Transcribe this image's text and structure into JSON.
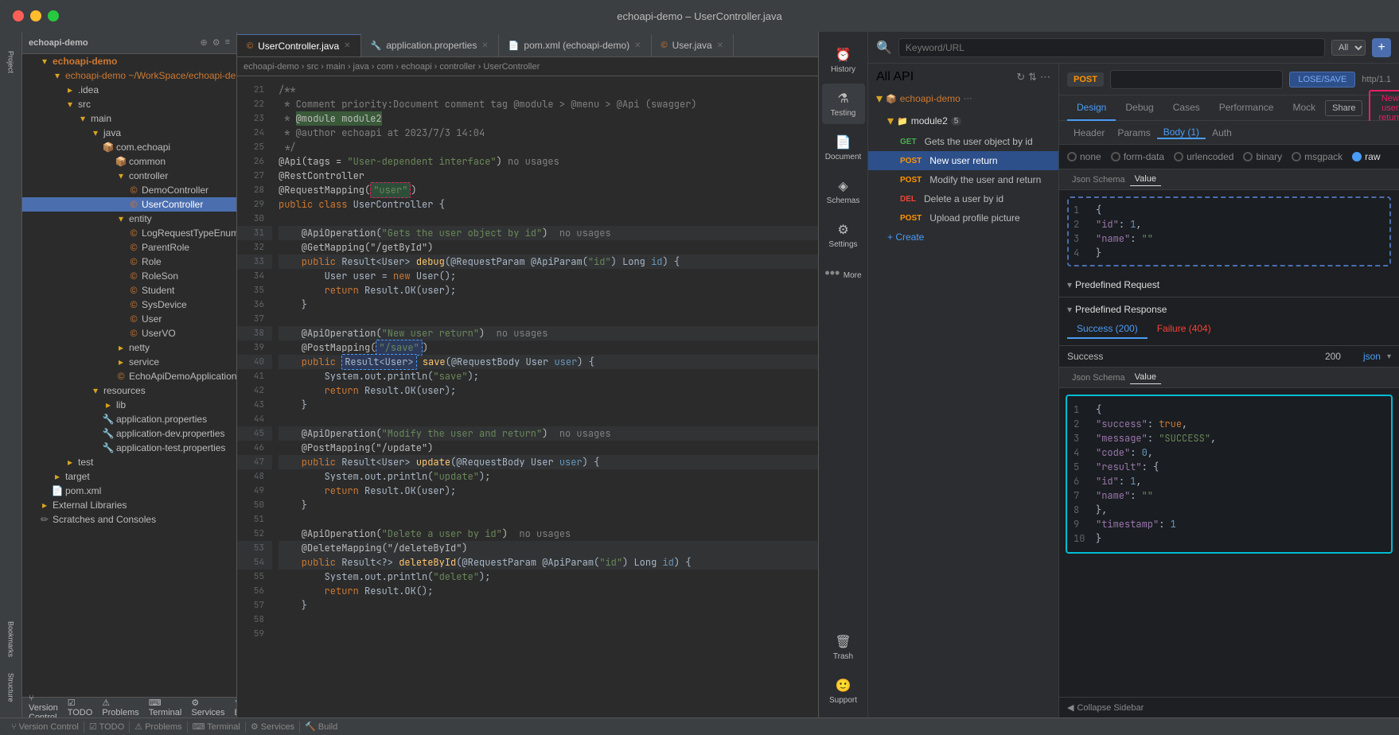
{
  "window": {
    "title": "echoapi-demo – UserController.java",
    "titlebar_buttons": [
      "close",
      "minimize",
      "maximize"
    ]
  },
  "editor": {
    "breadcrumb": "echoapi-demo › src › main › java › com › echoapi › controller › UserController",
    "tabs": [
      {
        "label": "UserController.java",
        "active": true
      },
      {
        "label": "application.properties",
        "active": false
      },
      {
        "label": "pom.xml (echoapi-demo)",
        "active": false
      },
      {
        "label": "User.java",
        "active": false
      }
    ],
    "lines": [
      {
        "num": 21,
        "code": "/**"
      },
      {
        "num": 22,
        "code": " * Comment priority:Document comment tag @module > @menu > @Api (swagger)"
      },
      {
        "num": 23,
        "code": " * @module module2"
      },
      {
        "num": 24,
        "code": " * @author echoapi at 2023/7/3 14:04"
      },
      {
        "num": 25,
        "code": " */"
      },
      {
        "num": 26,
        "code": "@Api(tags = \"User-dependent interface\")  no usages"
      },
      {
        "num": 27,
        "code": "@RestController"
      },
      {
        "num": 28,
        "code": "@RequestMapping(\"user\")"
      },
      {
        "num": 29,
        "code": "public class UserController {"
      },
      {
        "num": 30,
        "code": ""
      },
      {
        "num": 31,
        "code": "    @ApiOperation(\"Gets the user object by id\")  no usages"
      },
      {
        "num": 32,
        "code": "    @GetMapping(\"/getById\")"
      },
      {
        "num": 33,
        "code": "    public Result<User> debug(@RequestParam @ApiParam(\"id\") Long id) {"
      },
      {
        "num": 34,
        "code": "        User user = new User();"
      },
      {
        "num": 35,
        "code": "        return Result.OK(user);"
      },
      {
        "num": 36,
        "code": "    }"
      },
      {
        "num": 37,
        "code": ""
      },
      {
        "num": 38,
        "code": "    @ApiOperation(\"New user return\")  no usages"
      },
      {
        "num": 39,
        "code": "    @PostMapping(\"/save\")"
      },
      {
        "num": 40,
        "code": "    public Result<User> save(@RequestBody User user) {"
      },
      {
        "num": 41,
        "code": "        System.out.println(\"save\");"
      },
      {
        "num": 42,
        "code": "        return Result.OK(user);"
      },
      {
        "num": 43,
        "code": "    }"
      },
      {
        "num": 44,
        "code": ""
      },
      {
        "num": 45,
        "code": "    @ApiOperation(\"Modify the user and return\")  no usages"
      },
      {
        "num": 46,
        "code": "    @PostMapping(\"/update\")"
      },
      {
        "num": 47,
        "code": "    public Result<User> update(@RequestBody User user) {"
      },
      {
        "num": 48,
        "code": "        System.out.println(\"update\");"
      },
      {
        "num": 49,
        "code": "        return Result.OK(user);"
      },
      {
        "num": 50,
        "code": "    }"
      },
      {
        "num": 51,
        "code": ""
      },
      {
        "num": 52,
        "code": "    @ApiOperation(\"Delete a user by id\")  no usages"
      },
      {
        "num": 53,
        "code": "    @DeleteMapping(\"/deleteById\")"
      },
      {
        "num": 54,
        "code": "    public Result<?> deleteById(@RequestParam @ApiParam(\"id\") Long id) {"
      },
      {
        "num": 55,
        "code": "        System.out.println(\"delete\");"
      },
      {
        "num": 56,
        "code": "        return Result.OK();"
      },
      {
        "num": 57,
        "code": "    }"
      },
      {
        "num": 58,
        "code": ""
      },
      {
        "num": 59,
        "code": ""
      }
    ]
  },
  "file_tree": {
    "project_name": "Project",
    "items": [
      {
        "label": "echoapi-demo",
        "type": "root",
        "indent": 0
      },
      {
        "label": "echoapi-demo ~/WorkSpace/echoapi-demo",
        "type": "module",
        "indent": 1
      },
      {
        "label": ".idea",
        "type": "folder",
        "indent": 2
      },
      {
        "label": "src",
        "type": "folder",
        "indent": 2
      },
      {
        "label": "main",
        "type": "folder",
        "indent": 3
      },
      {
        "label": "java",
        "type": "folder",
        "indent": 4
      },
      {
        "label": "com.echoapi",
        "type": "package",
        "indent": 5
      },
      {
        "label": "common",
        "type": "package",
        "indent": 6
      },
      {
        "label": "controller",
        "type": "package",
        "indent": 6
      },
      {
        "label": "DemoController",
        "type": "java",
        "indent": 7
      },
      {
        "label": "UserController",
        "type": "java",
        "indent": 7,
        "selected": true
      },
      {
        "label": "entity",
        "type": "package",
        "indent": 6
      },
      {
        "label": "LogRequestTypeEnum",
        "type": "java",
        "indent": 7
      },
      {
        "label": "ParentRole",
        "type": "java",
        "indent": 7
      },
      {
        "label": "Role",
        "type": "java",
        "indent": 7
      },
      {
        "label": "RoleSon",
        "type": "java",
        "indent": 7
      },
      {
        "label": "Student",
        "type": "java",
        "indent": 7
      },
      {
        "label": "SysDevice",
        "type": "java",
        "indent": 7
      },
      {
        "label": "User",
        "type": "java",
        "indent": 7
      },
      {
        "label": "UserVO",
        "type": "java",
        "indent": 7
      },
      {
        "label": "netty",
        "type": "package",
        "indent": 6
      },
      {
        "label": "service",
        "type": "package",
        "indent": 6
      },
      {
        "label": "EchoApiDemoApplication",
        "type": "java",
        "indent": 6
      },
      {
        "label": "resources",
        "type": "folder",
        "indent": 5
      },
      {
        "label": "lib",
        "type": "folder",
        "indent": 6
      },
      {
        "label": "application.properties",
        "type": "file",
        "indent": 6
      },
      {
        "label": "application-dev.properties",
        "type": "file",
        "indent": 6
      },
      {
        "label": "application-test.properties",
        "type": "file",
        "indent": 6
      },
      {
        "label": "test",
        "type": "folder",
        "indent": 4
      },
      {
        "label": "target",
        "type": "folder",
        "indent": 3
      },
      {
        "label": "pom.xml",
        "type": "file",
        "indent": 3
      },
      {
        "label": "External Libraries",
        "type": "folder",
        "indent": 2
      },
      {
        "label": "Scratches and Consoles",
        "type": "folder",
        "indent": 2
      }
    ],
    "bottom_items": [
      "Version Control",
      "TODO",
      "Problems",
      "Terminal",
      "Services",
      "Build"
    ]
  },
  "api_panel": {
    "title": "echoapi-demo – UserController.java",
    "left_nav": [
      {
        "icon": "⏰",
        "label": "History"
      },
      {
        "icon": "⚗",
        "label": "Testing"
      },
      {
        "icon": "📄",
        "label": "Document"
      },
      {
        "icon": "🔷",
        "label": "Schemas"
      },
      {
        "icon": "⚙",
        "label": "Settings"
      },
      {
        "icon": "...",
        "label": "More"
      }
    ],
    "search": {
      "placeholder": "Keyword/URL",
      "filter": "All"
    },
    "all_api_label": "All API",
    "project": {
      "name": "echoapi-demo",
      "module": "module2",
      "badge": "5"
    },
    "api_list": [
      {
        "method": "GET",
        "label": "Gets the user object by id"
      },
      {
        "method": "POST",
        "label": "New user return",
        "selected": true
      },
      {
        "method": "POST",
        "label": "Modify the user and return"
      },
      {
        "method": "DEL",
        "label": "Delete a user by id"
      },
      {
        "method": "POST",
        "label": "Upload profile picture"
      }
    ],
    "create_label": "+ Create",
    "request": {
      "method": "POST",
      "url_value": "",
      "url_placeholder": "http/1.1",
      "save_label": "LOSE/SAVE",
      "title": "New user return",
      "tabs": [
        "Design",
        "Debug",
        "Cases",
        "Performance",
        "Mock"
      ],
      "active_tab": "Design",
      "share_label": "Share",
      "new_user_label": "New user return",
      "req_tabs": [
        "Header",
        "Params",
        "Body (1)",
        "Auth"
      ],
      "active_req_tab": "Body (1)",
      "body_types": [
        "none",
        "form-data",
        "urlencoded",
        "binary",
        "msgpack",
        "raw"
      ],
      "active_body_type": "raw",
      "code_tabs": [
        "Json Schema",
        "Value"
      ],
      "active_code_tab": "Value",
      "body_json": [
        "1  {",
        "2      \"id\": 1,",
        "3      \"name\": \"\"",
        "4  }"
      ]
    },
    "predefined_request_label": "Predefined Request",
    "predefined_response": {
      "label": "Predefined Response",
      "tabs": [
        "Success (200)",
        "Failure (404)"
      ],
      "active_tab": "Success (200)",
      "status_label": "Success",
      "status_code": "200",
      "format": "json",
      "code_tabs": [
        "Json Schema",
        "Value"
      ],
      "active_code_tab": "Value",
      "response_json": [
        "1   {",
        "2       \"success\": true,",
        "3       \"message\": \"SUCCESS\",",
        "4       \"code\": 0,",
        "5       \"result\": {",
        "6           \"id\": 1,",
        "7           \"name\": \"\"",
        "8       },",
        "9       \"timestamp\": 1",
        "10  }"
      ]
    },
    "collapse_sidebar_label": "Collapse Sidebar",
    "trash_label": "Trash",
    "support_label": "Support"
  },
  "status_bar": {
    "items": [
      "Version Control",
      "TODO",
      "Problems",
      "Terminal",
      "Services",
      "Build"
    ]
  }
}
